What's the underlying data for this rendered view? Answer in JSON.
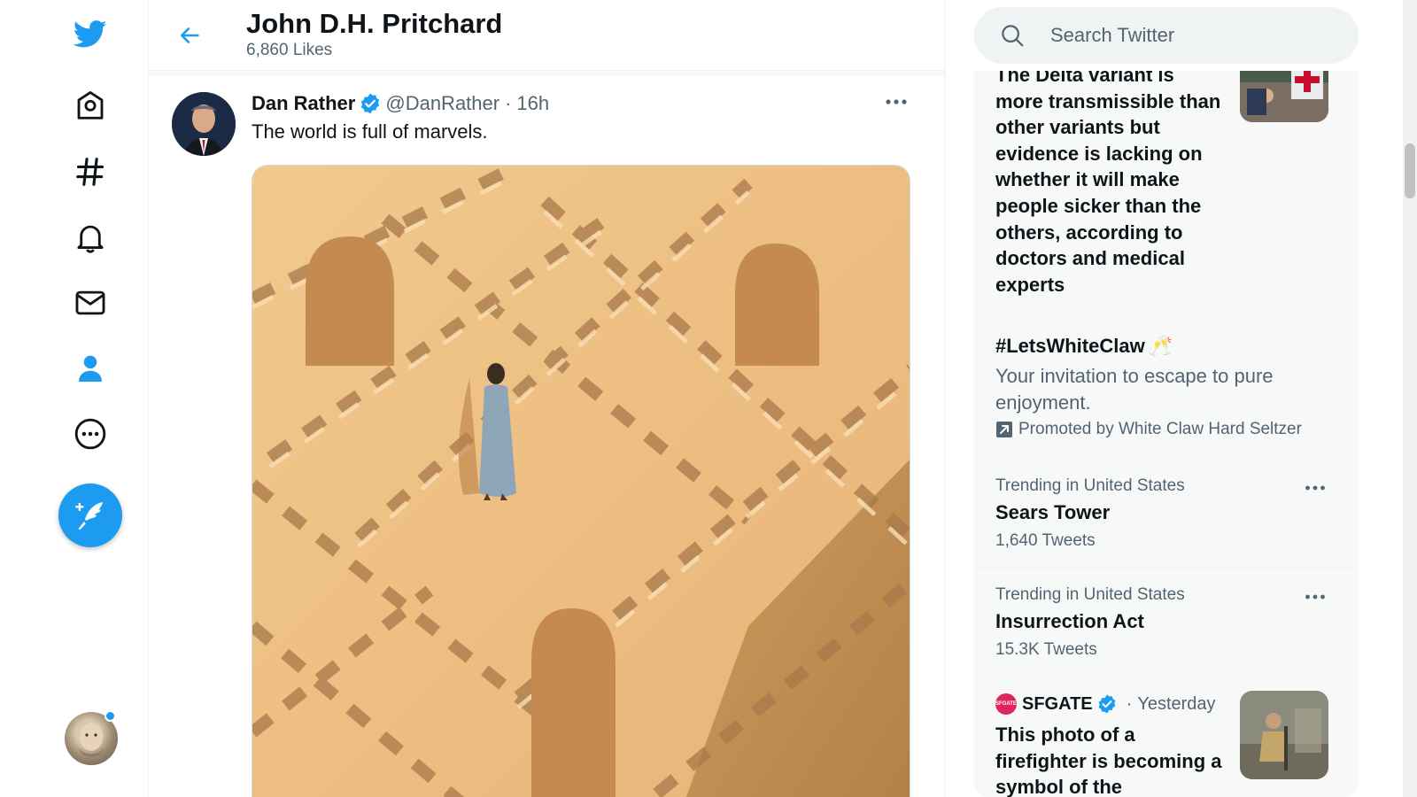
{
  "nav": {
    "items": [
      "Home",
      "Explore",
      "Notifications",
      "Messages",
      "Profile",
      "More"
    ],
    "compose_label": "Tweet"
  },
  "header": {
    "title": "John D.H. Pritchard",
    "subtitle": "6,860 Likes"
  },
  "tweet": {
    "name": "Dan Rather",
    "handle": "@DanRather",
    "dot": "·",
    "time": "16h",
    "text": "The world is full of marvels."
  },
  "search": {
    "placeholder": "Search Twitter"
  },
  "trends": {
    "news_top": {
      "text": "The Delta variant is more transmissible than other variants but evidence is lacking on whether it will make people sicker than the others, according to doctors and medical experts"
    },
    "promoted": {
      "title": "#LetsWhiteClaw",
      "emoji": "🥂",
      "description": "Your invitation to escape to pure enjoyment.",
      "promoted_by": "Promoted by White Claw Hard Seltzer"
    },
    "items": [
      {
        "context": "Trending in United States",
        "name": "Sears Tower",
        "count": "1,640 Tweets"
      },
      {
        "context": "Trending in United States",
        "name": "Insurrection Act",
        "count": "15.3K Tweets"
      }
    ],
    "news_bottom": {
      "source": "SFGATE",
      "source_logo_text": "SFGATE",
      "dot": "·",
      "time": "Yesterday",
      "text": "This photo of a firefighter is becoming a symbol of the"
    }
  },
  "colors": {
    "accent": "#1d9bf0",
    "secondary_text": "#536471",
    "sidebar_bg": "#f7f9f9"
  },
  "icons": [
    "twitter-logo-icon",
    "home-icon",
    "explore-hash-icon",
    "bell-icon",
    "mail-icon",
    "profile-icon",
    "more-circle-icon",
    "compose-feather-icon",
    "back-arrow-icon",
    "verified-badge-icon",
    "more-dots-icon",
    "search-icon",
    "promoted-arrow-icon"
  ]
}
